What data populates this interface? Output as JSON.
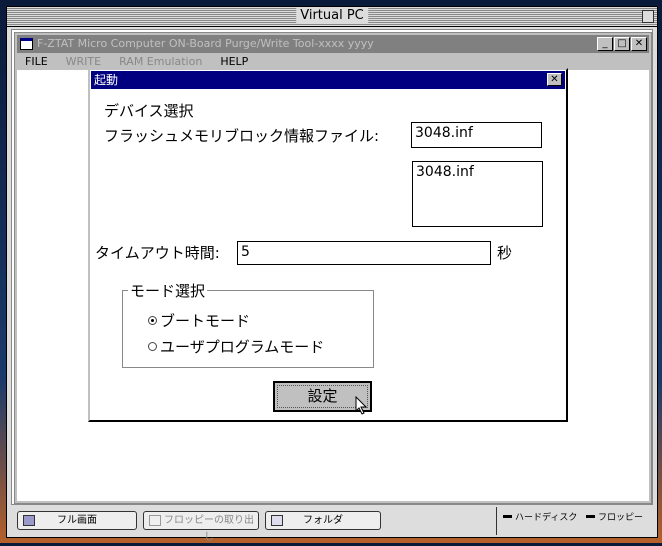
{
  "host": {
    "title": "Virtual PC"
  },
  "app": {
    "title": "F-ZTAT Micro Computer ON-Board Purge/Write Tool-xxxx yyyy",
    "menu": [
      "FILE",
      "WRITE",
      "RAM Emulation",
      "HELP"
    ]
  },
  "dialog": {
    "title": "起動",
    "close": "✕",
    "device_heading": "デバイス選択",
    "flash_label": "フラッシュメモリブロック情報ファイル:",
    "flash_value": "3048.inf",
    "flash_list": [
      "3048.inf"
    ],
    "timeout_label": "タイムアウト時間:",
    "timeout_value": "5",
    "timeout_unit": "秒",
    "mode_legend": "モード選択",
    "modes": [
      {
        "label": "ブートモード",
        "selected": true
      },
      {
        "label": "ユーザプログラムモード",
        "selected": false
      }
    ],
    "set_button": "設定"
  },
  "status": {
    "fullscreen": "フル画面",
    "eject_floppy": "フロッピーの取り出し",
    "folder": "フォルダ",
    "hdd": "ハードディスク",
    "floppy": "フロッピー"
  }
}
